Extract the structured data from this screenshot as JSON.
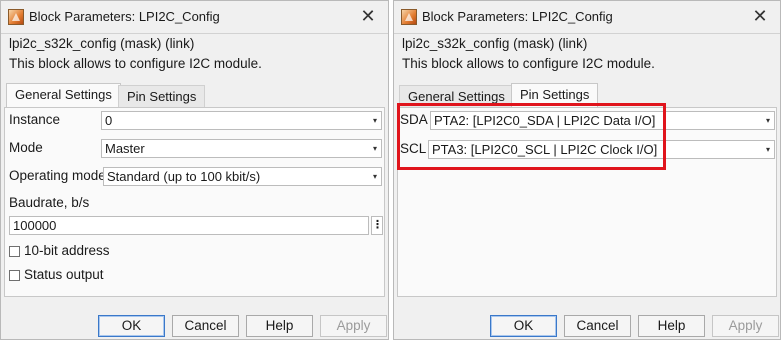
{
  "left_dialog": {
    "title": "Block Parameters: LPI2C_Config",
    "close_glyph": "✕",
    "mask_title": "lpi2c_s32k_config (mask) (link)",
    "description": "This block allows to configure I2C module.",
    "tabs": [
      {
        "label": "General Settings",
        "active": true
      },
      {
        "label": "Pin Settings",
        "active": false
      }
    ],
    "fields": {
      "instance_label": "Instance",
      "instance_value": "0",
      "mode_label": "Mode",
      "mode_value": "Master",
      "operating_mode_label": "Operating mode",
      "operating_mode_value": "Standard (up to 100 kbit/s)",
      "baudrate_label": "Baudrate, b/s",
      "baudrate_value": "100000",
      "ten_bit_label": "10-bit address",
      "ten_bit_checked": false,
      "status_output_label": "Status output",
      "status_output_checked": false
    },
    "buttons": {
      "ok": "OK",
      "cancel": "Cancel",
      "help": "Help",
      "apply": "Apply"
    }
  },
  "right_dialog": {
    "title": "Block Parameters: LPI2C_Config",
    "close_glyph": "✕",
    "mask_title": "lpi2c_s32k_config (mask) (link)",
    "description": "This block allows to configure I2C module.",
    "tabs": [
      {
        "label": "General Settings",
        "active": false
      },
      {
        "label": "Pin Settings",
        "active": true
      }
    ],
    "fields": {
      "sda_label": "SDA",
      "sda_value": "PTA2: [LPI2C0_SDA | LPI2C Data I/O]",
      "scl_label": "SCL",
      "scl_value": "PTA3: [LPI2C0_SCL | LPI2C Clock I/O]"
    },
    "buttons": {
      "ok": "OK",
      "cancel": "Cancel",
      "help": "Help",
      "apply": "Apply"
    }
  },
  "icons": {
    "window_icon": "simulink-block-icon",
    "dropdown_arrow": "▾",
    "kebab": "⋮"
  },
  "colors": {
    "highlight": "#e0141c",
    "primary_button_border": "#3a78c9",
    "disabled_text": "#9b9b9b"
  }
}
